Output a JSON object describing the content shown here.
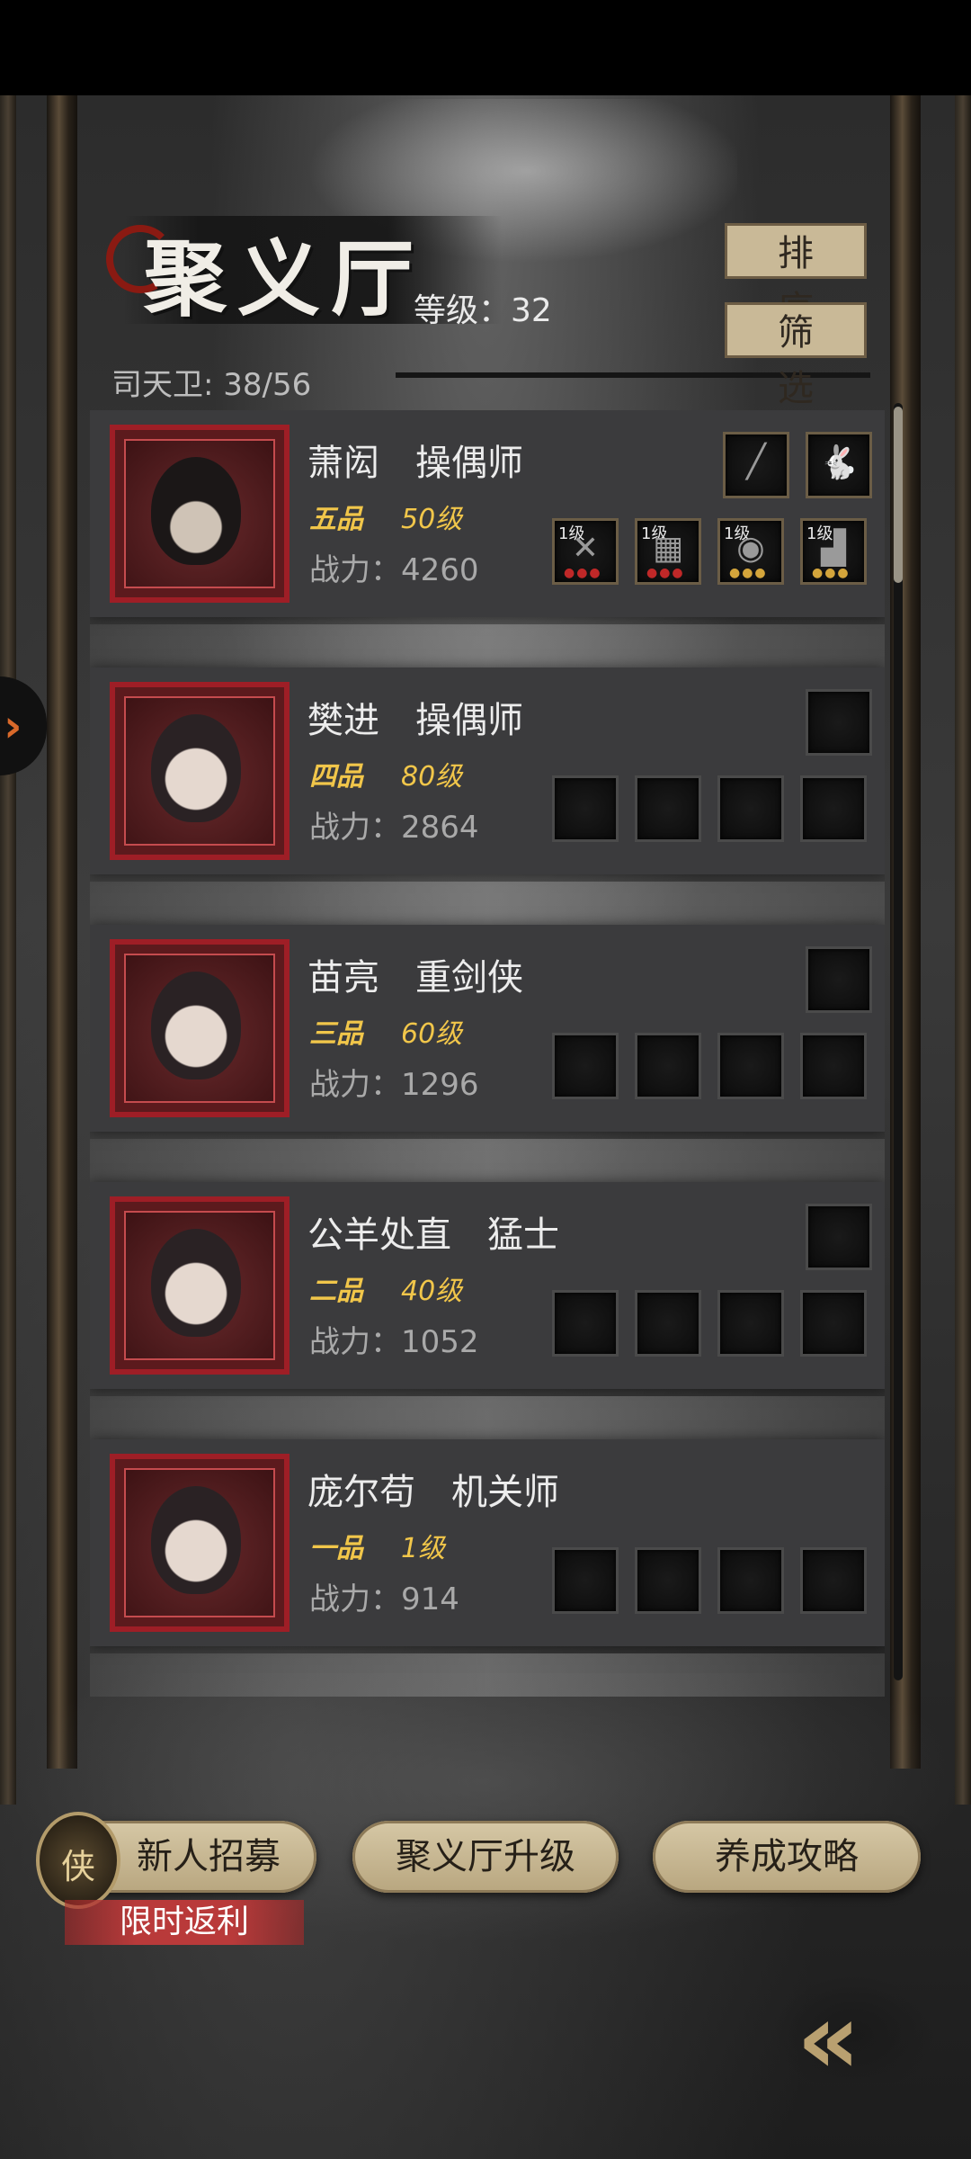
{
  "header": {
    "title": "聚义厅",
    "level_text": "等级：32",
    "guards_text": "司天卫: 38/56",
    "sort_label": "排序",
    "filter_label": "筛选"
  },
  "heroes": [
    {
      "name": "萧闳　操偶师",
      "rank": "五品",
      "level": "50级",
      "power": "战力：4260"
    },
    {
      "name": "樊进　操偶师",
      "rank": "四品",
      "level": "80级",
      "power": "战力：2864"
    },
    {
      "name": "苗亮　重剑侠",
      "rank": "三品",
      "level": "60级",
      "power": "战力：1296"
    },
    {
      "name": "公羊处直　猛士",
      "rank": "二品",
      "level": "40级",
      "power": "战力：1052"
    },
    {
      "name": "庞尔苟　机关师",
      "rank": "一品",
      "level": "1级",
      "power": "战力：914"
    }
  ],
  "equipment_tags": [
    "1级",
    "1级",
    "1级",
    "1级"
  ],
  "bottom": {
    "recruit_label": "新人招募",
    "upgrade_label": "聚义厅升级",
    "guide_label": "养成攻略",
    "promo_label": "限时返利",
    "badge_glyph": "侠"
  },
  "icons": {
    "side_tab": "chevron-icon",
    "back": "double-chevron-left-icon"
  },
  "colors": {
    "rank_gold": "#f1c64a",
    "portrait_red": "#9e1e26",
    "button_tan": "#c9b997"
  }
}
